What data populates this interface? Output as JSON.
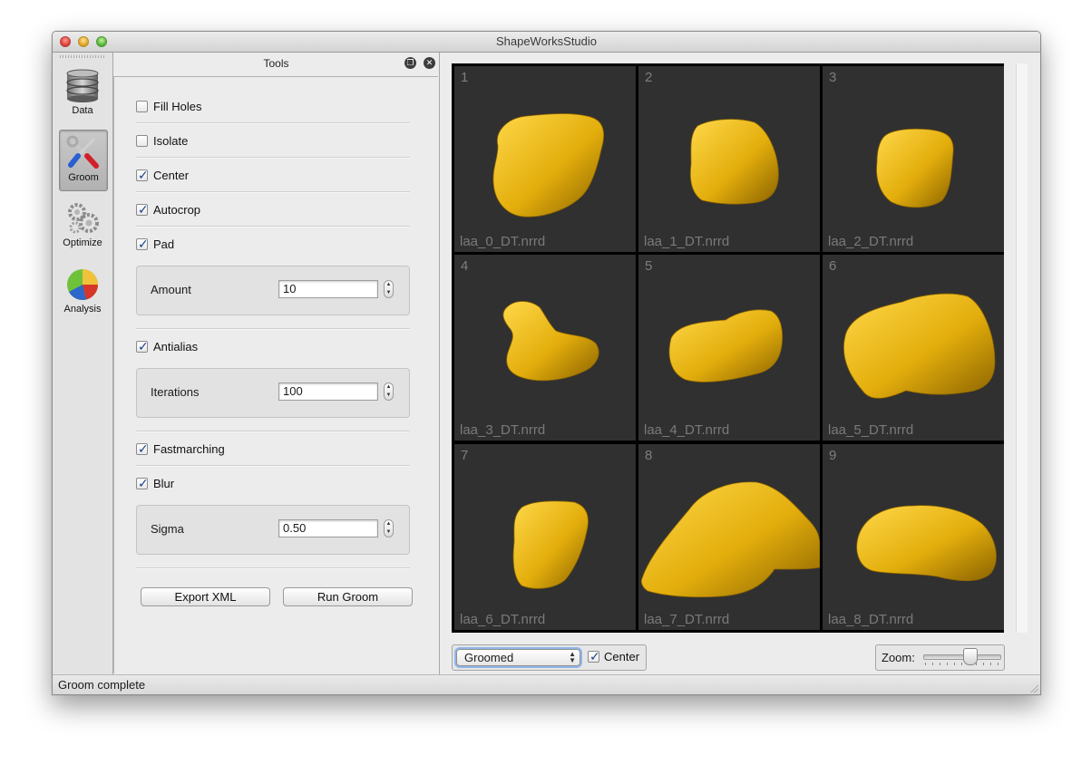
{
  "window": {
    "title": "ShapeWorksStudio"
  },
  "modules": [
    {
      "label": "Data",
      "icon": "database-icon",
      "active": false
    },
    {
      "label": "Groom",
      "icon": "tools-icon",
      "active": true
    },
    {
      "label": "Optimize",
      "icon": "gears-icon",
      "active": false
    },
    {
      "label": "Analysis",
      "icon": "pie-chart-icon",
      "active": false
    }
  ],
  "tools": {
    "title": "Tools",
    "fill_holes": {
      "label": "Fill Holes",
      "checked": false
    },
    "isolate": {
      "label": "Isolate",
      "checked": false
    },
    "center": {
      "label": "Center",
      "checked": true
    },
    "autocrop": {
      "label": "Autocrop",
      "checked": true
    },
    "pad": {
      "label": "Pad",
      "checked": true,
      "param_label": "Amount",
      "param_value": "10"
    },
    "antialias": {
      "label": "Antialias",
      "checked": true,
      "param_label": "Iterations",
      "param_value": "100"
    },
    "fastmarching": {
      "label": "Fastmarching",
      "checked": true
    },
    "blur": {
      "label": "Blur",
      "checked": true,
      "param_label": "Sigma",
      "param_value": "0.50"
    },
    "export_label": "Export XML",
    "run_label": "Run Groom"
  },
  "viewer": {
    "cells": [
      {
        "num": "1",
        "name": "laa_0_DT.nrrd"
      },
      {
        "num": "2",
        "name": "laa_1_DT.nrrd"
      },
      {
        "num": "3",
        "name": "laa_2_DT.nrrd"
      },
      {
        "num": "4",
        "name": "laa_3_DT.nrrd"
      },
      {
        "num": "5",
        "name": "laa_4_DT.nrrd"
      },
      {
        "num": "6",
        "name": "laa_5_DT.nrrd"
      },
      {
        "num": "7",
        "name": "laa_6_DT.nrrd"
      },
      {
        "num": "8",
        "name": "laa_7_DT.nrrd"
      },
      {
        "num": "9",
        "name": "laa_8_DT.nrrd"
      }
    ],
    "display_mode": "Groomed",
    "center_label": "Center",
    "center_checked": true,
    "zoom_label": "Zoom:",
    "zoom_level": 0.63
  },
  "status": {
    "text": "Groom complete"
  },
  "colors": {
    "shape": "#e3ae0c",
    "shape_dark": "#8a6200",
    "shape_light": "#ffd84a",
    "viewport": "#303030"
  }
}
